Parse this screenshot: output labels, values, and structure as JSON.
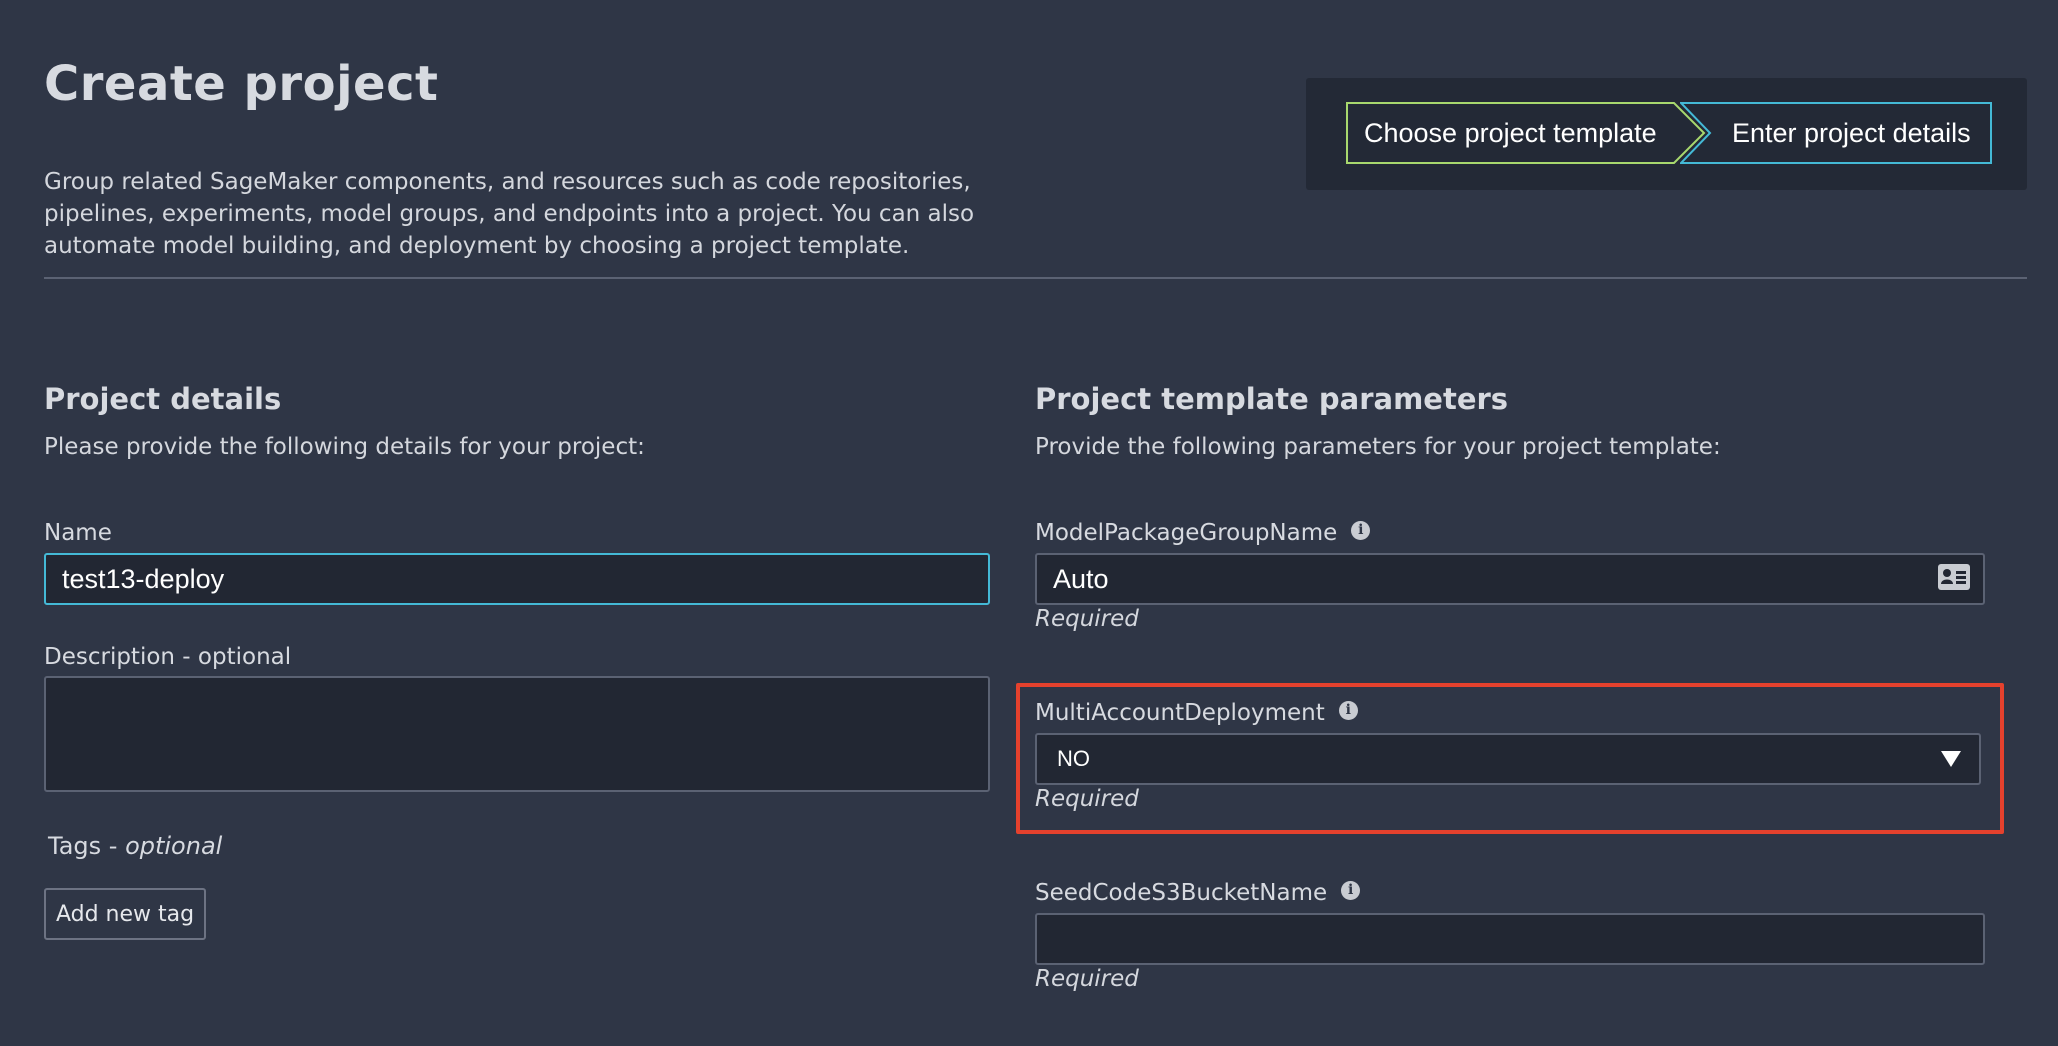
{
  "header": {
    "title": "Create project",
    "description": "Group related SageMaker components, and resources such as code repositories, pipelines, experiments, model groups, and endpoints into a project. You can also automate model building, and deployment by choosing a project template."
  },
  "stepper": {
    "steps": [
      {
        "label": "Choose project template",
        "state": "completed",
        "color": "#a8d86e"
      },
      {
        "label": "Enter project details",
        "state": "current",
        "color": "#44b9d6"
      }
    ]
  },
  "project_details": {
    "title": "Project details",
    "subtitle": "Please provide the following details for your project:",
    "name_label": "Name",
    "name_value": "test13-deploy",
    "description_label": "Description - optional",
    "description_value": "",
    "tags_label": "Tags - ",
    "tags_optional": "optional",
    "add_tag_label": "Add new tag"
  },
  "template_params": {
    "title": "Project template parameters",
    "subtitle": "Provide the following parameters for your project template:",
    "fields": [
      {
        "label": "ModelPackageGroupName",
        "value": "Auto",
        "hint": "Required",
        "icon": "info-icon"
      },
      {
        "label": "MultiAccountDeployment",
        "value": "NO",
        "hint": "Required",
        "icon": "info-icon",
        "highlighted": true,
        "highlight_color": "#e5412d"
      },
      {
        "label": "SeedCodeS3BucketName",
        "value": "",
        "hint": "Required",
        "icon": "info-icon"
      }
    ]
  }
}
